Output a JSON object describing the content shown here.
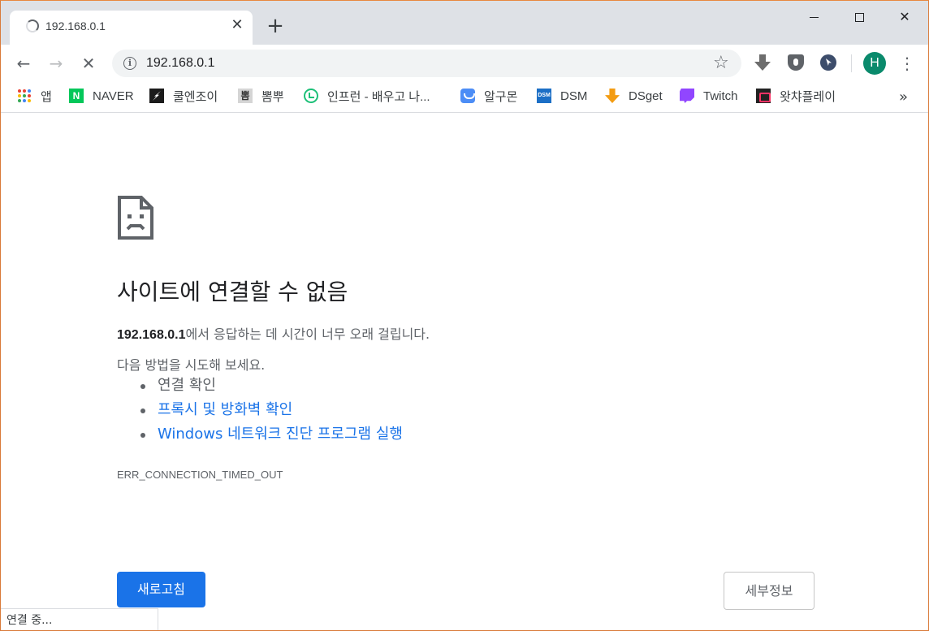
{
  "window": {
    "tab_title": "192.168.0.1",
    "new_tab_symbol": "+",
    "close_symbol": "✕",
    "minimize_icon": "minimize-icon",
    "maximize_icon": "maximize-icon",
    "close_icon": "close-icon"
  },
  "toolbar": {
    "back_icon": "←",
    "forward_icon": "→",
    "stop_icon": "✕",
    "info_icon": "i",
    "url": "192.168.0.1",
    "star_icon": "☆",
    "avatar_initial": "H",
    "menu_icon": "⋮"
  },
  "bookmarks": {
    "items": [
      {
        "label": "앱",
        "icon": "apps-grid-icon"
      },
      {
        "label": "NAVER",
        "icon": "naver-icon",
        "icon_text": "N"
      },
      {
        "label": "쿨엔조이",
        "icon": "coolenjoy-icon"
      },
      {
        "label": "뽐뿌",
        "icon": "ppomppu-icon",
        "icon_text": "뽐"
      },
      {
        "label": "인프런 - 배우고 나...",
        "icon": "inflearn-icon"
      },
      {
        "label": "알구몬",
        "icon": "algumon-icon"
      },
      {
        "label": "DSM",
        "icon": "dsm-icon",
        "icon_text": "DSM"
      },
      {
        "label": "DSget",
        "icon": "dsget-icon"
      },
      {
        "label": "Twitch",
        "icon": "twitch-icon"
      },
      {
        "label": "왓챠플레이",
        "icon": "watcha-icon"
      }
    ],
    "more": "»"
  },
  "error": {
    "title": "사이트에 연결할 수 없음",
    "host": "192.168.0.1",
    "desc_suffix": "에서 응답하는 데 시간이 너무 오래 걸립니다.",
    "try_label": "다음 방법을 시도해 보세요.",
    "suggestions": [
      {
        "text": "연결 확인",
        "link": false
      },
      {
        "text": "프록시 및 방화벽 확인",
        "link": true
      },
      {
        "text": "Windows 네트워크 진단 프로그램 실행",
        "link": true
      }
    ],
    "code": "ERR_CONNECTION_TIMED_OUT",
    "reload_label": "새로고침",
    "details_label": "세부정보"
  },
  "status": {
    "text": "연결 중..."
  },
  "colors": {
    "accent": "#1a73e8",
    "avatar_bg": "#0a8a6c",
    "tabstrip_bg": "#dee1e6",
    "window_border": "#e8873f"
  }
}
